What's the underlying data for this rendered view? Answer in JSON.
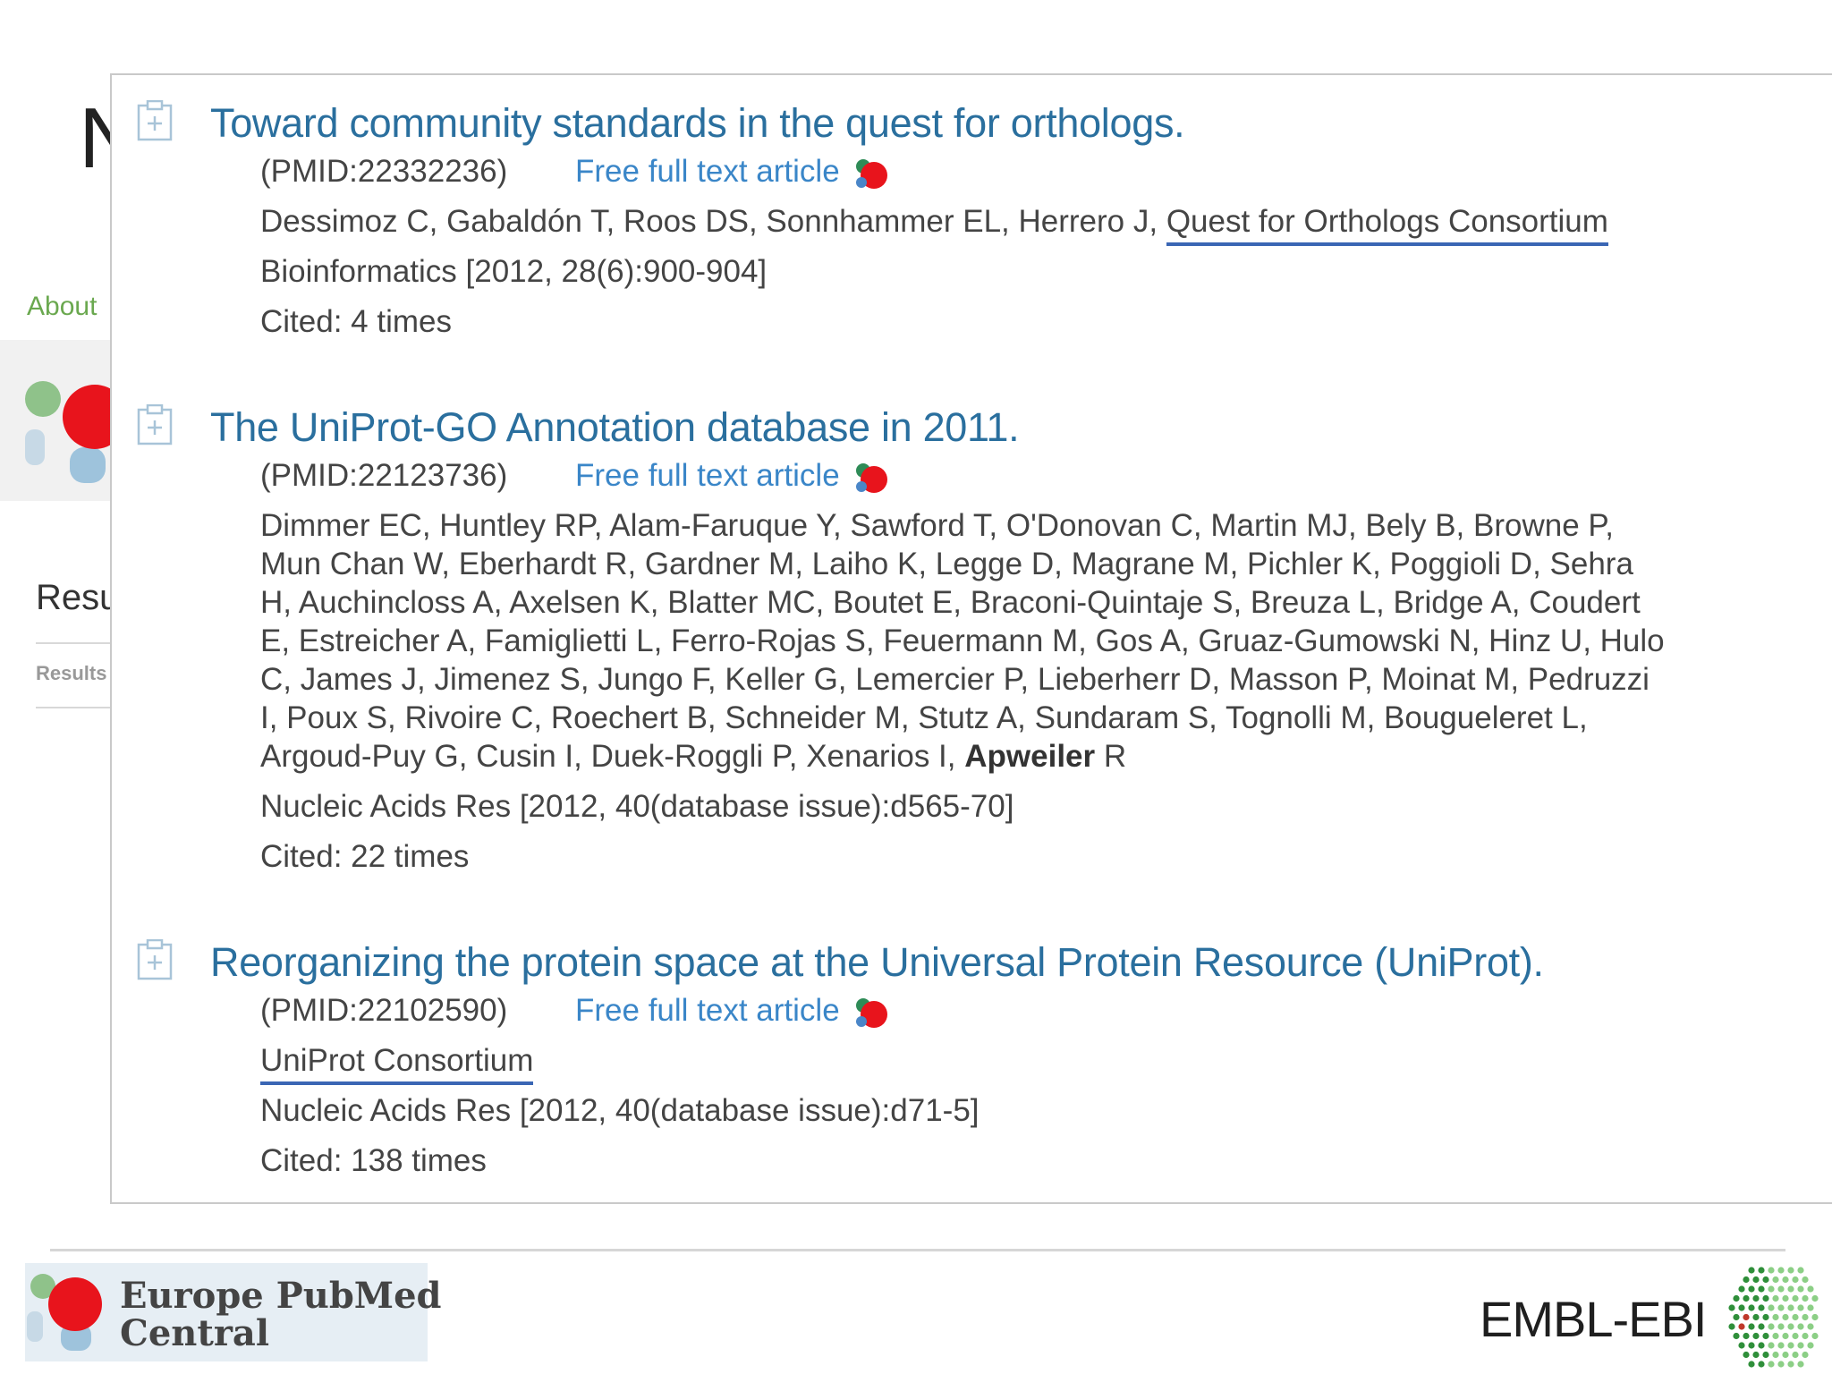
{
  "background": {
    "title_fragment": "N",
    "about_link": "About",
    "results_heading": "Resu",
    "results_sub": "Results"
  },
  "results": [
    {
      "title": "Toward community standards in the quest for orthologs.",
      "pmid": "(PMID:22332236)",
      "full_text_link": "Free full text article",
      "authors": "Dessimoz C, Gabaldón T, Roos DS, Sonnhammer EL, Herrero J,",
      "authors_highlight": "Quest for Orthologs Consortium",
      "journal": "Bioinformatics [2012, 28(6):900-904]",
      "cited": "Cited:  4 times"
    },
    {
      "title": "The UniProt-GO Annotation database in 2011.",
      "pmid": "(PMID:22123736)",
      "full_text_link": "Free full text article",
      "authors_lines": [
        "Dimmer EC, Huntley RP, Alam-Faruque Y, Sawford T, O'Donovan C, Martin MJ, Bely B, Browne P,",
        "Mun Chan W, Eberhardt R, Gardner M, Laiho K, Legge D, Magrane M, Pichler K, Poggioli D, Sehra",
        "H, Auchincloss A, Axelsen K, Blatter MC, Boutet E, Braconi-Quintaje S, Breuza L, Bridge A, Coudert",
        "E, Estreicher A, Famiglietti L, Ferro-Rojas S, Feuermann M, Gos A, Gruaz-Gumowski N, Hinz U, Hulo",
        "C, James J, Jimenez S, Jungo F, Keller G, Lemercier P, Lieberherr D, Masson P, Moinat M, Pedruzzi",
        "I, Poux S, Rivoire C, Roechert B, Schneider M, Stutz A, Sundaram S, Tognolli M, Bougueleret L,"
      ],
      "authors_last_prefix": "Argoud-Puy G, Cusin I, Duek-Roggli P, Xenarios I,",
      "authors_last_bold": "Apweiler",
      "authors_last_suffix": "R",
      "journal": "Nucleic Acids Res [2012, 40(database issue):d565-70]",
      "cited": "Cited:  22 times"
    },
    {
      "title": "Reorganizing the protein space at the Universal Protein Resource (UniProt).",
      "pmid": "(PMID:22102590)",
      "full_text_link": "Free full text article",
      "authors_highlight": "UniProt Consortium",
      "journal": "Nucleic Acids Res [2012, 40(database issue):d71-5]",
      "cited": "Cited:  138 times"
    }
  ],
  "footer": {
    "epmc_line1": "Europe PubMed",
    "epmc_line2": "Central",
    "embl": "EMBL-EBI"
  },
  "icons": {
    "entry_icon": "bookmark-add-icon",
    "open_access_icon": "free-access-icon"
  },
  "colors": {
    "title_link": "#2a6f9e",
    "link": "#3a86c8",
    "highlight_underline": "#3a66b4",
    "body_text": "#444444",
    "brand_red": "#e8141c"
  }
}
